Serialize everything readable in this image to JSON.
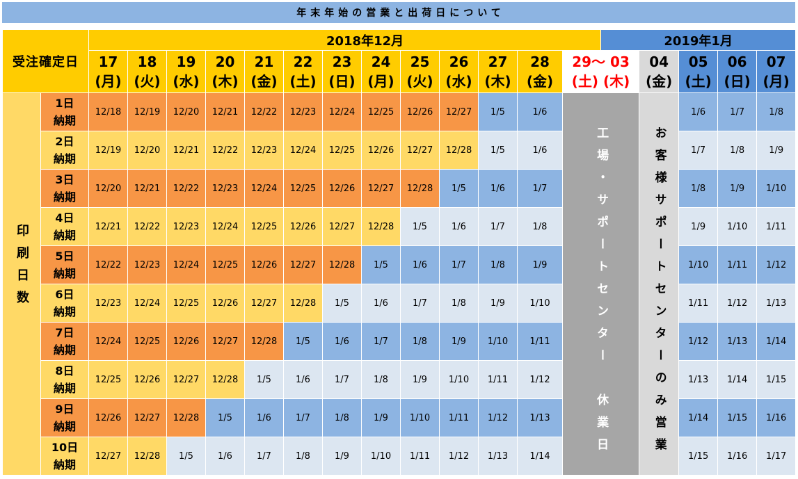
{
  "title": "年末年始の営業と出荷日について",
  "header": {
    "order_date_label": "受注確定日",
    "month_dec": "2018年12月",
    "month_jan": "2019年1月",
    "dec_days": [
      {
        "day": "17",
        "weekday": "(月)"
      },
      {
        "day": "18",
        "weekday": "(火)"
      },
      {
        "day": "19",
        "weekday": "(水)"
      },
      {
        "day": "20",
        "weekday": "(木)"
      },
      {
        "day": "21",
        "weekday": "(金)"
      },
      {
        "day": "22",
        "weekday": "(土)"
      },
      {
        "day": "23",
        "weekday": "(日)"
      },
      {
        "day": "24",
        "weekday": "(月)"
      },
      {
        "day": "25",
        "weekday": "(火)"
      },
      {
        "day": "26",
        "weekday": "(水)"
      },
      {
        "day": "27",
        "weekday": "(木)"
      },
      {
        "day": "28",
        "weekday": "(金)"
      }
    ],
    "closure_day": {
      "day": "29～ 03",
      "weekday": "(土) (木)"
    },
    "support_day": {
      "day": "04",
      "weekday": "(金)"
    },
    "jan_days": [
      {
        "day": "05",
        "weekday": "(土)"
      },
      {
        "day": "06",
        "weekday": "(日)"
      },
      {
        "day": "07",
        "weekday": "(月)"
      }
    ]
  },
  "side_label": "印刷日数",
  "closures": {
    "factory": [
      "工場・サポートセンター",
      "休業日"
    ],
    "support": "お客様サポートセンターのみ営業"
  },
  "rows": [
    {
      "days": "1日",
      "term": "納期",
      "cells": [
        "12/18",
        "12/19",
        "12/20",
        "12/21",
        "12/22",
        "12/23",
        "12/24",
        "12/25",
        "12/26",
        "12/27",
        "1/5",
        "1/6"
      ],
      "jan_cells": [
        "1/6",
        "1/7",
        "1/8"
      ]
    },
    {
      "days": "2日",
      "term": "納期",
      "cells": [
        "12/19",
        "12/20",
        "12/21",
        "12/22",
        "12/23",
        "12/24",
        "12/25",
        "12/26",
        "12/27",
        "12/28",
        "1/5",
        "1/6"
      ],
      "jan_cells": [
        "1/7",
        "1/8",
        "1/9"
      ]
    },
    {
      "days": "3日",
      "term": "納期",
      "cells": [
        "12/20",
        "12/21",
        "12/22",
        "12/23",
        "12/24",
        "12/25",
        "12/26",
        "12/27",
        "12/28",
        "1/5",
        "1/6",
        "1/7"
      ],
      "jan_cells": [
        "1/8",
        "1/9",
        "1/10"
      ]
    },
    {
      "days": "4日",
      "term": "納期",
      "cells": [
        "12/21",
        "12/22",
        "12/23",
        "12/24",
        "12/25",
        "12/26",
        "12/27",
        "12/28",
        "1/5",
        "1/6",
        "1/7",
        "1/8"
      ],
      "jan_cells": [
        "1/9",
        "1/10",
        "1/11"
      ]
    },
    {
      "days": "5日",
      "term": "納期",
      "cells": [
        "12/22",
        "12/23",
        "12/24",
        "12/25",
        "12/26",
        "12/27",
        "12/28",
        "1/5",
        "1/6",
        "1/7",
        "1/8",
        "1/9"
      ],
      "jan_cells": [
        "1/10",
        "1/11",
        "1/12"
      ]
    },
    {
      "days": "6日",
      "term": "納期",
      "cells": [
        "12/23",
        "12/24",
        "12/25",
        "12/26",
        "12/27",
        "12/28",
        "1/5",
        "1/6",
        "1/7",
        "1/8",
        "1/9",
        "1/10"
      ],
      "jan_cells": [
        "1/11",
        "1/12",
        "1/13"
      ]
    },
    {
      "days": "7日",
      "term": "納期",
      "cells": [
        "12/24",
        "12/25",
        "12/26",
        "12/27",
        "12/28",
        "1/5",
        "1/6",
        "1/7",
        "1/8",
        "1/9",
        "1/10",
        "1/11"
      ],
      "jan_cells": [
        "1/12",
        "1/13",
        "1/14"
      ]
    },
    {
      "days": "8日",
      "term": "納期",
      "cells": [
        "12/25",
        "12/26",
        "12/27",
        "12/28",
        "1/5",
        "1/6",
        "1/7",
        "1/8",
        "1/9",
        "1/10",
        "1/11",
        "1/12"
      ],
      "jan_cells": [
        "1/13",
        "1/14",
        "1/15"
      ]
    },
    {
      "days": "9日",
      "term": "納期",
      "cells": [
        "12/26",
        "12/27",
        "12/28",
        "1/5",
        "1/6",
        "1/7",
        "1/8",
        "1/9",
        "1/10",
        "1/11",
        "1/12",
        "1/13"
      ],
      "jan_cells": [
        "1/14",
        "1/15",
        "1/16"
      ]
    },
    {
      "days": "10日",
      "term": "納期",
      "cells": [
        "12/27",
        "12/28",
        "1/5",
        "1/6",
        "1/7",
        "1/8",
        "1/9",
        "1/10",
        "1/11",
        "1/12",
        "1/13",
        "1/14"
      ],
      "jan_cells": [
        "1/15",
        "1/16",
        "1/17"
      ]
    }
  ],
  "colors": {
    "title_bg": "#8DB4E2",
    "header_yellow": "#FFCC00",
    "header_blue": "#558ED5",
    "holiday_red": "#FF0000",
    "support_bg": "#D9D9D9",
    "closed_bg": "#A6A6A6",
    "closed_text": "#FFFFFF",
    "dec_strong": "#F79646",
    "dec_light": "#FFD966",
    "jan_strong": "#8DB4E2",
    "jan_light": "#DCE6F1",
    "grid": "#FFFFFF"
  }
}
